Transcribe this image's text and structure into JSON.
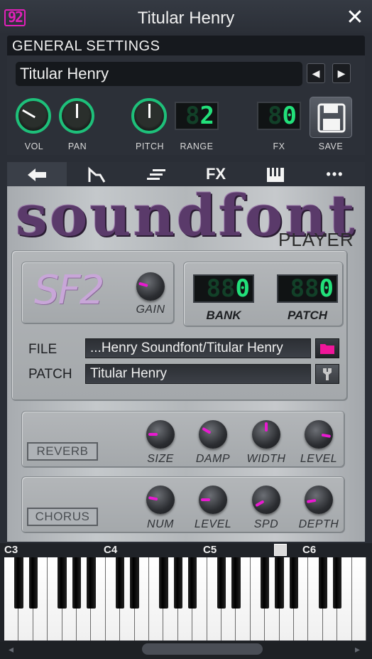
{
  "window": {
    "title": "Titular Henry",
    "logo_text": "92",
    "close_glyph": "✕"
  },
  "general_settings": {
    "heading": "GENERAL SETTINGS",
    "instrument_name": "Titular Henry",
    "prev_glyph": "◀",
    "next_glyph": "▶",
    "vol_label": "VOL",
    "pan_label": "PAN",
    "pitch_label": "PITCH",
    "range_label": "RANGE",
    "range_value": "2",
    "range_dim": "8",
    "fx_label": "FX",
    "fx_value": "0",
    "fx_dim": "8",
    "save_label": "SAVE"
  },
  "tabs": [
    {
      "name": "back-arrow-icon",
      "glyph": "🡄"
    },
    {
      "name": "envelope-icon",
      "glyph": "⎍"
    },
    {
      "name": "functions-icon",
      "glyph": "≡"
    },
    {
      "name": "fx-tab",
      "glyph": "FX"
    },
    {
      "name": "piano-icon",
      "glyph": "Ⅲ"
    },
    {
      "name": "more-icon",
      "glyph": "•••"
    }
  ],
  "plugin": {
    "title": "soundfont",
    "subtitle": "PLAYER",
    "sf2_logo": "SF2",
    "gain_label": "GAIN",
    "bank_label": "BANK",
    "bank_value": "0",
    "bank_dim": "88",
    "patch_label": "PATCH",
    "patch_value": "0",
    "patch_dim": "88",
    "file_label": "FILE",
    "file_value": "...Henry Soundfont/Titular Henry",
    "patch_field_label": "PATCH",
    "patch_field_value": "Titular Henry",
    "reverb_button": "REVERB",
    "reverb_knobs": [
      "SIZE",
      "DAMP",
      "WIDTH",
      "LEVEL"
    ],
    "chorus_button": "CHORUS",
    "chorus_knobs": [
      "NUM",
      "LEVEL",
      "SPD",
      "DEPTH"
    ]
  },
  "keyboard": {
    "octave_labels": [
      "C3",
      "C4",
      "C5",
      "C6"
    ],
    "scroll_left": "◂",
    "scroll_right": "▸"
  },
  "colors": {
    "accent_green": "#22e07a",
    "knob_accent": "#e81ad0",
    "logo_pink": "#e020b8"
  }
}
